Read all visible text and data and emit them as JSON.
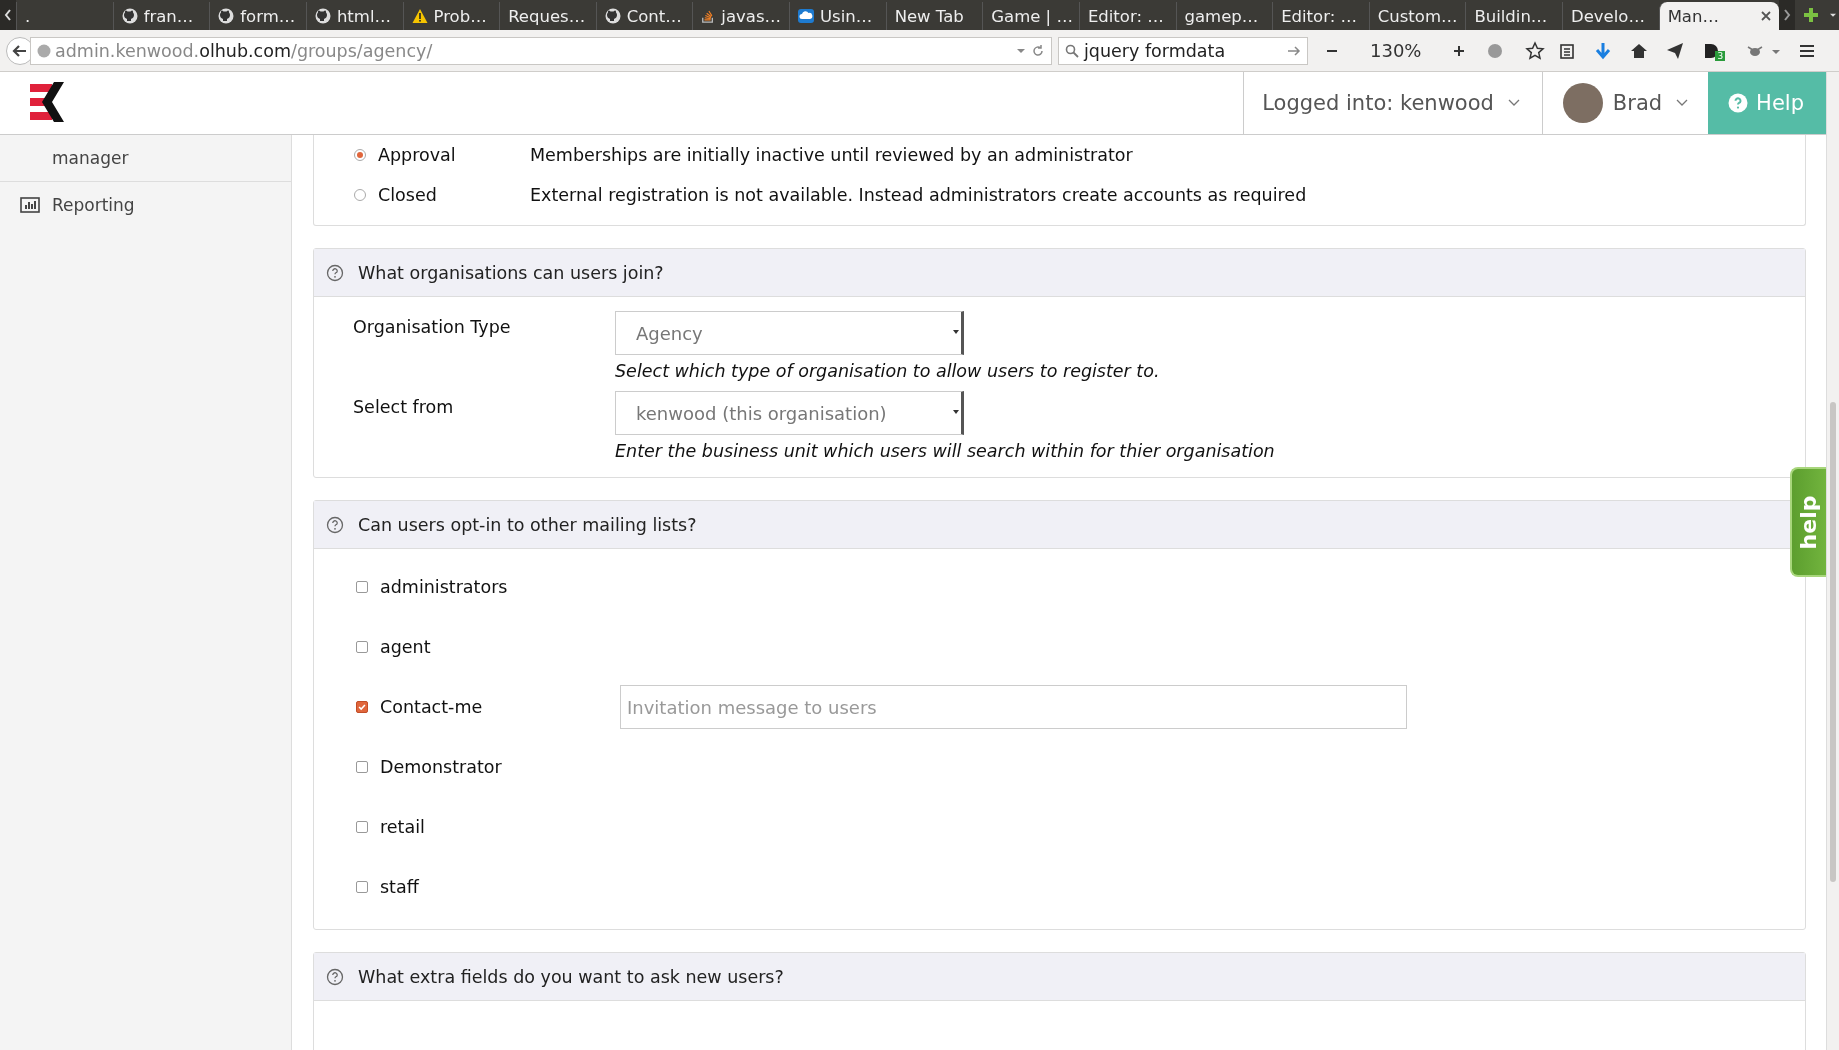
{
  "browser": {
    "tabs": [
      {
        "label": ".",
        "kind": "plain",
        "selected": false
      },
      {
        "label": "fran…",
        "kind": "github",
        "selected": false
      },
      {
        "label": "form…",
        "kind": "github",
        "selected": false
      },
      {
        "label": "html…",
        "kind": "github",
        "selected": false
      },
      {
        "label": "Prob…",
        "kind": "warning",
        "selected": false
      },
      {
        "label": "Reques…",
        "kind": "plain",
        "selected": false
      },
      {
        "label": "Cont…",
        "kind": "github",
        "selected": false
      },
      {
        "label": "javas…",
        "kind": "stack",
        "selected": false
      },
      {
        "label": "Usin…",
        "kind": "cloud",
        "selected": false
      },
      {
        "label": "New Tab",
        "kind": "plain",
        "selected": false
      },
      {
        "label": "Game | …",
        "kind": "plain",
        "selected": false
      },
      {
        "label": "Editor: …",
        "kind": "plain",
        "selected": false
      },
      {
        "label": "gamep…",
        "kind": "plain",
        "selected": false
      },
      {
        "label": "Editor: …",
        "kind": "plain",
        "selected": false
      },
      {
        "label": "Custom…",
        "kind": "plain",
        "selected": false
      },
      {
        "label": "Buildin…",
        "kind": "plain",
        "selected": false
      },
      {
        "label": "Develo…",
        "kind": "plain",
        "selected": false
      },
      {
        "label": "Man…",
        "kind": "plain",
        "selected": true
      }
    ],
    "url_prefix": "admin.kenwood.",
    "url_host": "olhub.com",
    "url_path": "/groups/agency/",
    "search": "jquery formdata",
    "zoom": "130%",
    "badge": "3"
  },
  "header": {
    "logged_into": "Logged into: kenwood",
    "user": "Brad",
    "help": "Help"
  },
  "sidebar": {
    "items": [
      {
        "label": "manager"
      },
      {
        "label": "Reporting",
        "kind": "chart"
      }
    ]
  },
  "membership_options": [
    {
      "label": "Approval",
      "description": "Memberships are initially inactive until reviewed by an administrator",
      "selected": true
    },
    {
      "label": "Closed",
      "description": "External registration is not available. Instead administrators create accounts as required",
      "selected": false
    }
  ],
  "organisations": {
    "title": "What organisations can users join?",
    "fields": [
      {
        "label": "Organisation Type",
        "value": "Agency",
        "help": "Select which type of organisation to allow users to register to."
      },
      {
        "label": "Select from",
        "value": "kenwood (this organisation)",
        "help": "Enter the business unit which users will search within for thier organisation"
      }
    ]
  },
  "mailing_lists": {
    "title": "Can users opt-in to other mailing lists?",
    "items": [
      {
        "label": "administrators",
        "checked": false
      },
      {
        "label": "agent",
        "checked": false
      },
      {
        "label": "Contact-me",
        "checked": true,
        "placeholder": "Invitation message to users"
      },
      {
        "label": "Demonstrator",
        "checked": false
      },
      {
        "label": "retail",
        "checked": false
      },
      {
        "label": "staff",
        "checked": false
      }
    ]
  },
  "extra_fields": {
    "title": "What extra fields do you want to ask new users?"
  },
  "side_help": "help"
}
